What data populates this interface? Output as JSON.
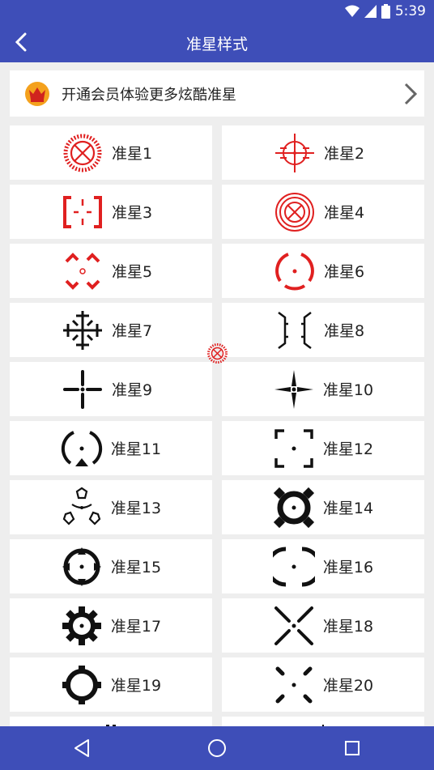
{
  "status_bar": {
    "time": "5:39",
    "battery": "8"
  },
  "toolbar": {
    "title": "准星样式",
    "back_icon": "back-arrow-icon"
  },
  "vip_banner": {
    "text": "开通会员体验更多炫酷准星",
    "crown_icon": "crown-icon",
    "arrow_icon": "chevron-right-icon"
  },
  "crosshairs": [
    {
      "label": "准星1",
      "color": "#E02020"
    },
    {
      "label": "准星2",
      "color": "#E02020"
    },
    {
      "label": "准星3",
      "color": "#E02020"
    },
    {
      "label": "准星4",
      "color": "#E02020"
    },
    {
      "label": "准星5",
      "color": "#E02020"
    },
    {
      "label": "准星6",
      "color": "#E02020"
    },
    {
      "label": "准星7",
      "color": "#111111"
    },
    {
      "label": "准星8",
      "color": "#111111"
    },
    {
      "label": "准星9",
      "color": "#111111"
    },
    {
      "label": "准星10",
      "color": "#111111"
    },
    {
      "label": "准星11",
      "color": "#111111"
    },
    {
      "label": "准星12",
      "color": "#111111"
    },
    {
      "label": "准星13",
      "color": "#111111"
    },
    {
      "label": "准星14",
      "color": "#111111"
    },
    {
      "label": "准星15",
      "color": "#111111"
    },
    {
      "label": "准星16",
      "color": "#111111"
    },
    {
      "label": "准星17",
      "color": "#111111"
    },
    {
      "label": "准星18",
      "color": "#111111"
    },
    {
      "label": "准星19",
      "color": "#111111"
    },
    {
      "label": "准星20",
      "color": "#111111"
    }
  ],
  "nav_bar": {
    "back_icon": "nav-back-icon",
    "home_icon": "nav-home-icon",
    "recents_icon": "nav-recents-icon"
  },
  "colors": {
    "primary": "#3E4EB8",
    "background": "#EEEEEE",
    "red": "#E02020"
  }
}
